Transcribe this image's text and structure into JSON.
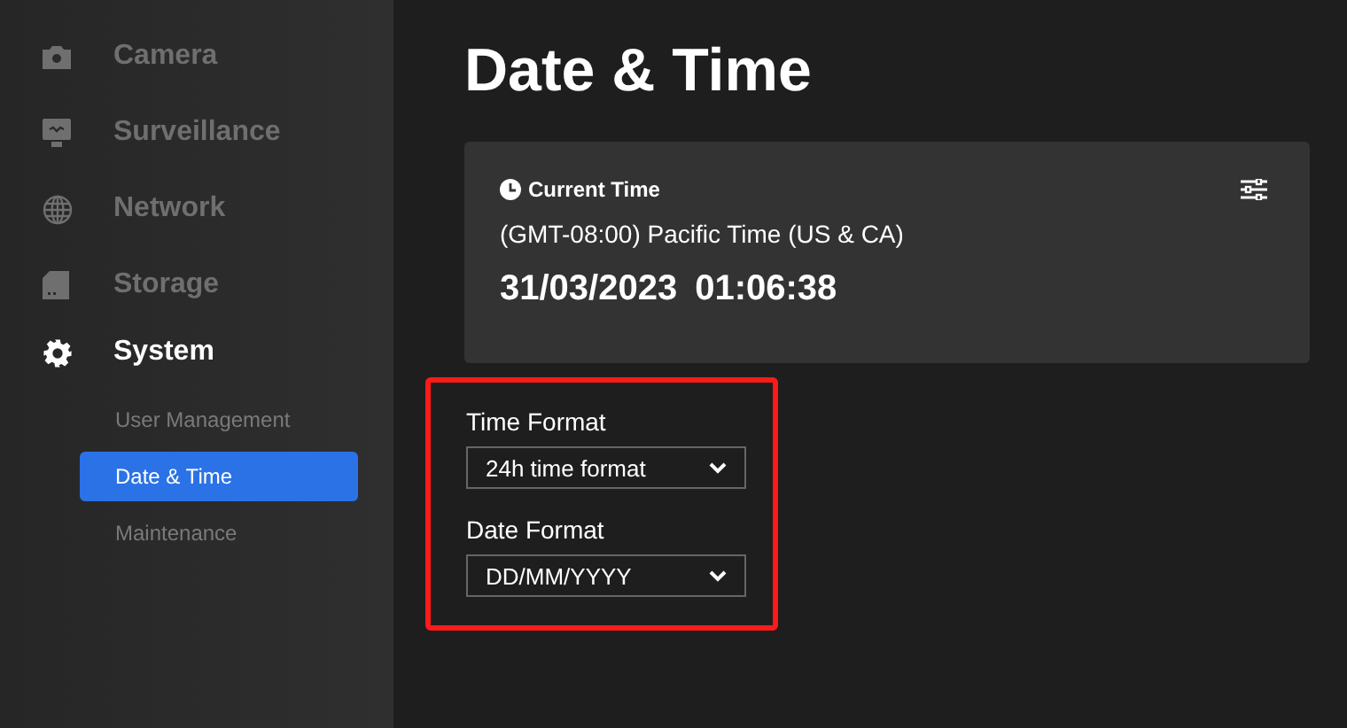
{
  "sidebar": {
    "items": [
      {
        "label": "Camera",
        "kind": "camera",
        "selected": false
      },
      {
        "label": "Surveillance",
        "kind": "monitor",
        "selected": false
      },
      {
        "label": "Network",
        "kind": "globe",
        "selected": false
      },
      {
        "label": "Storage",
        "kind": "card",
        "selected": false
      },
      {
        "label": "System",
        "kind": "gear",
        "selected": true,
        "children": [
          {
            "label": "User Management",
            "selected": false
          },
          {
            "label": "Date & Time",
            "selected": true
          },
          {
            "label": "Maintenance",
            "selected": false
          }
        ]
      }
    ]
  },
  "page_title": "Date & Time",
  "current_time": {
    "heading": "Current Time",
    "timezone": "(GMT-08:00) Pacific Time (US & CA)",
    "date": "31/03/2023",
    "time": "01:06:38"
  },
  "form": {
    "highlighted": true,
    "fields": [
      {
        "label": "Time Format",
        "value": "24h time format"
      },
      {
        "label": "Date Format",
        "value": "DD/MM/YYYY"
      }
    ]
  }
}
